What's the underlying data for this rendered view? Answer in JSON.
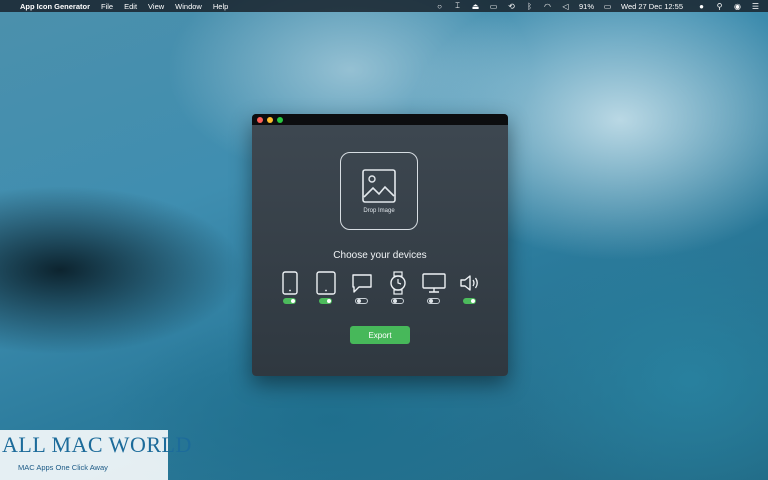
{
  "menubar": {
    "apple_icon": "apple-logo",
    "app_name": "App Icon Generator",
    "menus": [
      "File",
      "Edit",
      "View",
      "Window",
      "Help"
    ],
    "status": {
      "battery": "91%",
      "datetime": "Wed 27 Dec  12:55",
      "icons": [
        "circle-icon",
        "cursor-icon",
        "airplay-icon",
        "display-icon",
        "time-machine-icon",
        "bluetooth-icon",
        "wifi-icon",
        "volume-icon",
        "battery-icon",
        "user-icon",
        "search-icon",
        "siri-icon",
        "notification-list-icon"
      ]
    }
  },
  "window": {
    "drop_label": "Drop Image",
    "heading": "Choose your devices",
    "devices": [
      {
        "icon": "iphone-icon",
        "enabled": true
      },
      {
        "icon": "ipad-icon",
        "enabled": true
      },
      {
        "icon": "message-icon",
        "enabled": false
      },
      {
        "icon": "watch-icon",
        "enabled": false
      },
      {
        "icon": "monitor-icon",
        "enabled": false
      },
      {
        "icon": "speaker-icon",
        "enabled": true
      }
    ],
    "export_label": "Export"
  },
  "watermark": {
    "title": "ALL MAC WORLD",
    "subtitle": "MAC Apps One Click Away"
  },
  "colors": {
    "accent_green": "#47b85a",
    "window_bg": "#343d45"
  }
}
